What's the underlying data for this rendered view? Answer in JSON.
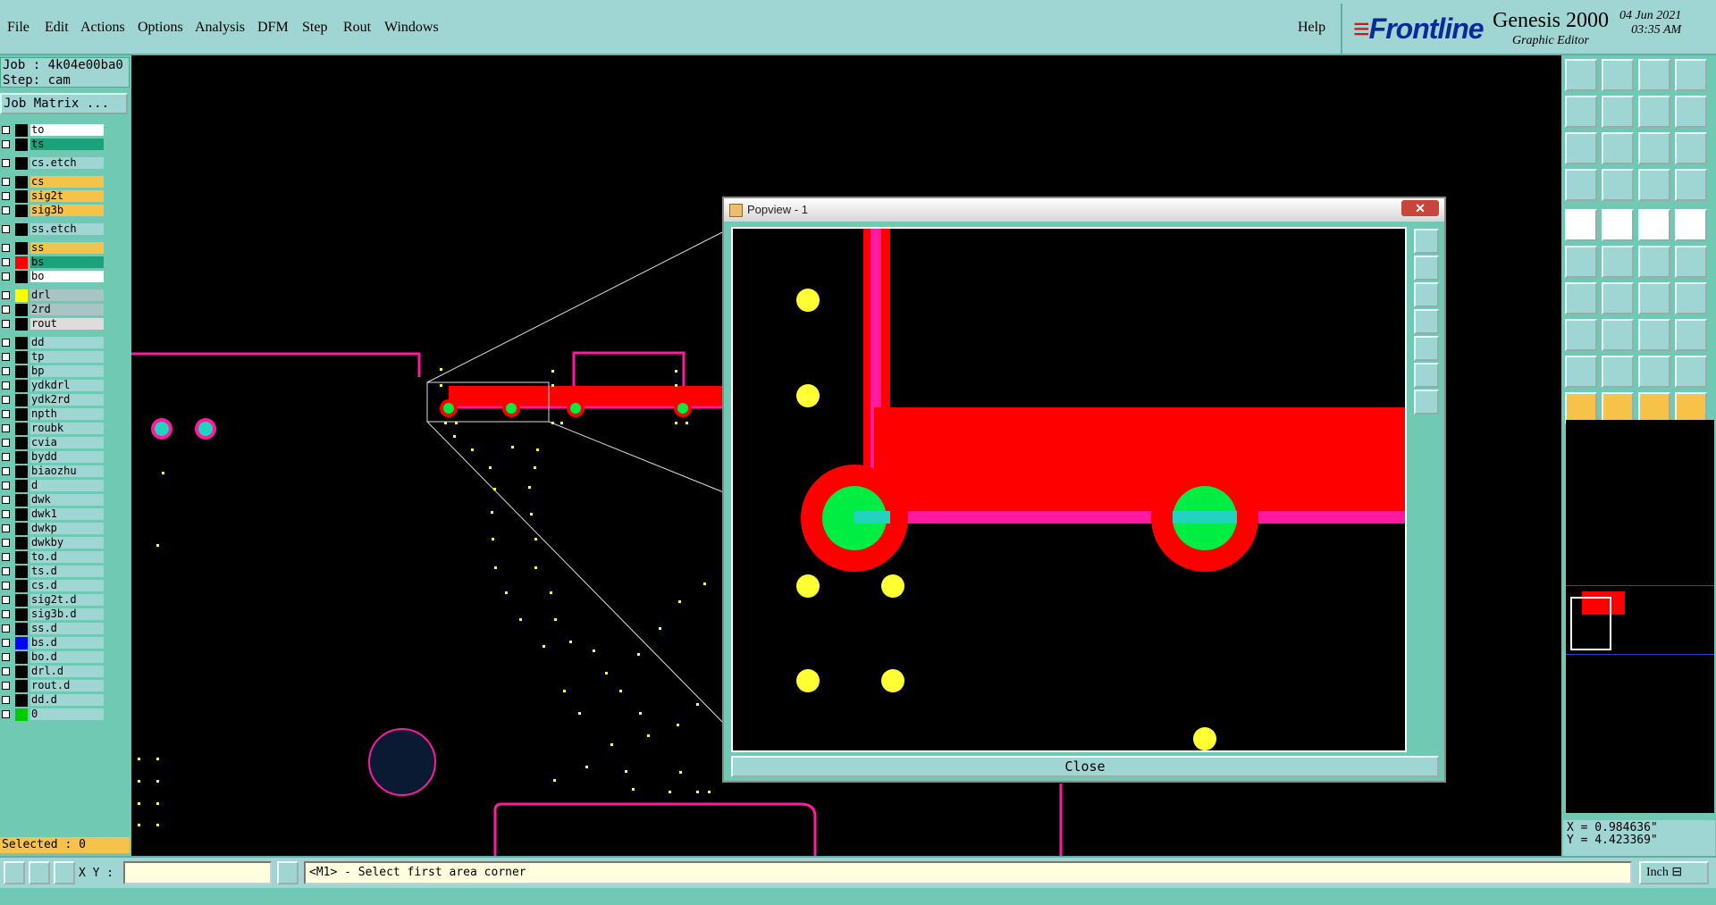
{
  "menu": [
    "File",
    "Edit",
    "Actions",
    "Options",
    "Analysis",
    "DFM",
    "Step",
    "Rout",
    "Windows"
  ],
  "help": "Help",
  "brand": {
    "logo": "Frontline",
    "product": "Genesis 2000",
    "subtitle": "Graphic Editor",
    "date": "04 Jun 2021",
    "time": "03:35 AM"
  },
  "job": {
    "line1": "Job : 4k04e00ba0",
    "line2": "Step: cam",
    "matrix_button": "Job Matrix ..."
  },
  "layers": [
    {
      "name": "to",
      "bg": "#ffffff",
      "swatch": "#000000",
      "gap": false
    },
    {
      "name": "ts",
      "bg": "#1aa37a",
      "swatch": "#000000",
      "gap": false
    },
    {
      "name": "cs.etch",
      "bg": "#9fd5d3",
      "swatch": "#000000",
      "gap": true
    },
    {
      "name": "cs",
      "bg": "#f6c24a",
      "swatch": "#000000",
      "gap": true
    },
    {
      "name": "sig2t",
      "bg": "#f6c24a",
      "swatch": "#000000",
      "gap": false
    },
    {
      "name": "sig3b",
      "bg": "#f6c24a",
      "swatch": "#000000",
      "gap": false
    },
    {
      "name": "ss.etch",
      "bg": "#9fd5d3",
      "swatch": "#000000",
      "gap": true
    },
    {
      "name": "ss",
      "bg": "#f6c24a",
      "swatch": "#000000",
      "gap": true
    },
    {
      "name": "bs",
      "bg": "#1aa37a",
      "swatch": "#ff0000",
      "gap": false
    },
    {
      "name": "bo",
      "bg": "#ffffff",
      "swatch": "#000000",
      "gap": false
    },
    {
      "name": "drl",
      "bg": "#a8c4c4",
      "swatch": "#ffff00",
      "gap": true
    },
    {
      "name": "2rd",
      "bg": "#a8c4c4",
      "swatch": "#000000",
      "gap": false
    },
    {
      "name": "rout",
      "bg": "#dddddd",
      "swatch": "#000000",
      "gap": false
    },
    {
      "name": "dd",
      "bg": "#9fd5d3",
      "swatch": "#000000",
      "gap": true
    },
    {
      "name": "tp",
      "bg": "#9fd5d3",
      "swatch": "#000000",
      "gap": false
    },
    {
      "name": "bp",
      "bg": "#9fd5d3",
      "swatch": "#000000",
      "gap": false
    },
    {
      "name": "ydkdrl",
      "bg": "#9fd5d3",
      "swatch": "#000000",
      "gap": false
    },
    {
      "name": "ydk2rd",
      "bg": "#9fd5d3",
      "swatch": "#000000",
      "gap": false
    },
    {
      "name": "npth",
      "bg": "#9fd5d3",
      "swatch": "#000000",
      "gap": false
    },
    {
      "name": "roubk",
      "bg": "#9fd5d3",
      "swatch": "#000000",
      "gap": false
    },
    {
      "name": "cvia",
      "bg": "#9fd5d3",
      "swatch": "#000000",
      "gap": false
    },
    {
      "name": "bydd",
      "bg": "#9fd5d3",
      "swatch": "#000000",
      "gap": false
    },
    {
      "name": "biaozhu",
      "bg": "#9fd5d3",
      "swatch": "#000000",
      "gap": false
    },
    {
      "name": "d",
      "bg": "#9fd5d3",
      "swatch": "#000000",
      "gap": false
    },
    {
      "name": "dwk",
      "bg": "#9fd5d3",
      "swatch": "#000000",
      "gap": false
    },
    {
      "name": "dwk1",
      "bg": "#9fd5d3",
      "swatch": "#000000",
      "gap": false
    },
    {
      "name": "dwkp",
      "bg": "#9fd5d3",
      "swatch": "#000000",
      "gap": false
    },
    {
      "name": "dwkby",
      "bg": "#9fd5d3",
      "swatch": "#000000",
      "gap": false
    },
    {
      "name": "to.d",
      "bg": "#9fd5d3",
      "swatch": "#000000",
      "gap": false
    },
    {
      "name": "ts.d",
      "bg": "#9fd5d3",
      "swatch": "#000000",
      "gap": false
    },
    {
      "name": "cs.d",
      "bg": "#9fd5d3",
      "swatch": "#000000",
      "gap": false
    },
    {
      "name": "sig2t.d",
      "bg": "#9fd5d3",
      "swatch": "#000000",
      "gap": false
    },
    {
      "name": "sig3b.d",
      "bg": "#9fd5d3",
      "swatch": "#000000",
      "gap": false
    },
    {
      "name": "ss.d",
      "bg": "#9fd5d3",
      "swatch": "#000000",
      "gap": false
    },
    {
      "name": "bs.d",
      "bg": "#9fd5d3",
      "swatch": "#0000ff",
      "gap": false
    },
    {
      "name": "bo.d",
      "bg": "#9fd5d3",
      "swatch": "#000000",
      "gap": false
    },
    {
      "name": "drl.d",
      "bg": "#9fd5d3",
      "swatch": "#000000",
      "gap": false
    },
    {
      "name": "rout.d",
      "bg": "#9fd5d3",
      "swatch": "#000000",
      "gap": false
    },
    {
      "name": "dd.d",
      "bg": "#9fd5d3",
      "swatch": "#000000",
      "gap": false
    },
    {
      "name": "0",
      "bg": "#9fd5d3",
      "swatch": "#00cc00",
      "gap": false
    }
  ],
  "selected": "Selected : 0",
  "popview": {
    "title": "Popview - 1",
    "close_label": "Close"
  },
  "coords": {
    "x": "X = 0.984636\"",
    "y": "Y = 4.423369\""
  },
  "status": {
    "xy_label": "X Y :",
    "xy_value": "",
    "prompt": "<M1> - Select first area corner",
    "units": "Inch"
  },
  "colors": {
    "panel": "#9fd5d3",
    "panel_dark": "#6fc9b3",
    "trace": "#ff1aa0",
    "pad": "#ff0000",
    "via": "#00ee44",
    "drill": "#ffff33"
  }
}
